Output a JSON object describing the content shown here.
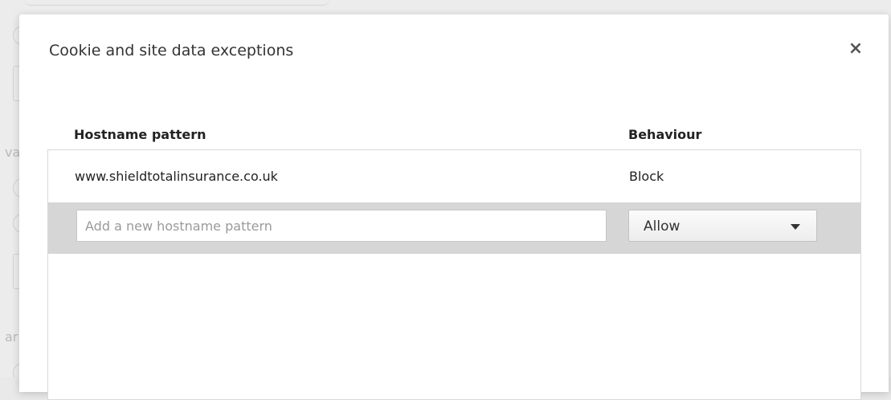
{
  "dialog": {
    "title": "Cookie and site data exceptions",
    "close_glyph": "×"
  },
  "columns": {
    "hostname": "Hostname pattern",
    "behaviour": "Behaviour"
  },
  "exceptions": [
    {
      "hostname": "www.shieldtotalinsurance.co.uk",
      "behaviour": "Block"
    }
  ],
  "new_entry": {
    "placeholder": "Add a new hostname pattern",
    "value": "",
    "behaviour_selected": "Allow"
  },
  "background": {
    "chars": [
      "va",
      "ar"
    ]
  },
  "colors": {
    "new_row_bg": "#d6d6d6",
    "dialog_bg": "#ffffff",
    "backdrop": "#ececec"
  }
}
